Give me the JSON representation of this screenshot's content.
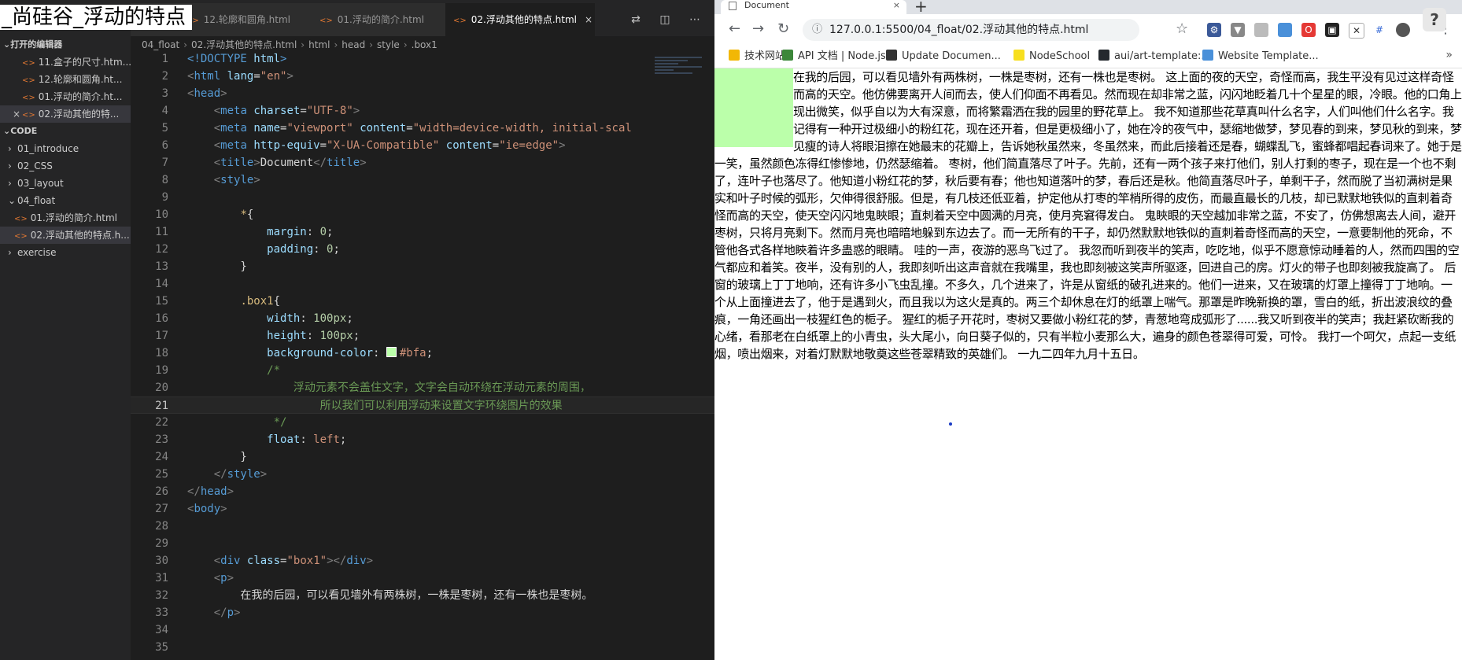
{
  "overlay_title": "_尚硅谷_浮动的特点",
  "vscode": {
    "sidebar": {
      "open_editors_title": "打开的编辑器",
      "open_editors": [
        {
          "label": "11.盒子的尺寸.htm..."
        },
        {
          "label": "12.轮廓和圆角.ht..."
        },
        {
          "label": "01.浮动的简介.ht..."
        },
        {
          "label": "02.浮动其他的特...",
          "active": true
        }
      ],
      "workspace_title": "CODE",
      "tree": [
        {
          "label": "01_introduce",
          "chevron": "›"
        },
        {
          "label": "02_CSS",
          "chevron": "›"
        },
        {
          "label": "03_layout",
          "chevron": "›"
        },
        {
          "label": "04_float",
          "chevron": "⌄"
        },
        {
          "label": "01.浮动的简介.html",
          "child": true
        },
        {
          "label": "02.浮动其他的特点.h...",
          "child": true,
          "active": true
        },
        {
          "label": "exercise",
          "chevron": "›"
        }
      ]
    },
    "tabs": [
      {
        "label": "html"
      },
      {
        "label": "12.轮廓和圆角.html"
      },
      {
        "label": "01.浮动的简介.html"
      },
      {
        "label": "02.浮动其他的特点.html",
        "active": true
      }
    ],
    "tab_close_glyph": "×",
    "editor_actions": "⇄ ◫ ⋯",
    "breadcrumb": [
      "04_float",
      "02.浮动其他的特点.html",
      "html",
      "head",
      "style",
      ".box1"
    ],
    "current_line": 21
  },
  "browser": {
    "tab_title": "Document",
    "tab_close": "×",
    "new_tab": "+",
    "help_badge": "?",
    "nav": {
      "back": "←",
      "forward": "→",
      "reload": "↻"
    },
    "url": "127.0.0.1:5500/04_float/02.浮动其他的特点.html",
    "star": "☆",
    "bookmarks": [
      {
        "label": "技术网站",
        "color": "#f2b705"
      },
      {
        "label": "API 文档 | Node.js...",
        "color": "#3c873a"
      },
      {
        "label": "Update Documen...",
        "color": "#333333"
      },
      {
        "label": "NodeSchool",
        "color": "#f7df1e"
      },
      {
        "label": "aui/art-template:...",
        "color": "#24292e"
      },
      {
        "label": "Website Template...",
        "color": "#4a90d9"
      }
    ],
    "bookmarks_more": "»",
    "page_text": "在我的后园，可以看见墙外有两株树，一株是枣树，还有一株也是枣树。 这上面的夜的天空，奇怪而高，我生平没有见过这样奇怪而高的天空。他仿佛要离开人间而去，使人们仰面不再看见。然而现在却非常之蓝，闪闪地眨着几十个星星的眼，冷眼。他的口角上现出微笑，似乎自以为大有深意，而将繁霜洒在我的园里的野花草上。 我不知道那些花草真叫什么名字，人们叫他们什么名字。我记得有一种开过极细小的粉红花，现在还开着，但是更极细小了，她在冷的夜气中，瑟缩地做梦，梦见春的到来，梦见秋的到来，梦见瘦的诗人将眼泪擦在她最末的花瓣上，告诉她秋虽然来，冬虽然来，而此后接着还是春，蝴蝶乱飞，蜜蜂都唱起春词来了。她于是一笑，虽然颜色冻得红惨惨地，仍然瑟缩着。 枣树，他们简直落尽了叶子。先前，还有一两个孩子来打他们，别人打剩的枣子，现在是一个也不剩了，连叶子也落尽了。他知道小粉红花的梦，秋后要有春；他也知道落叶的梦，春后还是秋。他简直落尽叶子，单剩干子，然而脱了当初满树是果实和叶子时候的弧形，欠伸得很舒服。但是，有几枝还低亚着，护定他从打枣的竿梢所得的皮伤，而最直最长的几枝，却已默默地铁似的直刺着奇怪而高的天空，使天空闪闪地鬼䀹眼；直刺着天空中圆满的月亮，使月亮窘得发白。 鬼䀹眼的天空越加非常之蓝，不安了，仿佛想离去人间，避开枣树，只将月亮剩下。然而月亮也暗暗地躲到东边去了。而一无所有的干子，却仍然默默地铁似的直刺着奇怪而高的天空，一意要制他的死命，不管他各式各样地䀹着许多蛊惑的眼睛。 哇的一声，夜游的恶鸟飞过了。 我忽而听到夜半的笑声，吃吃地，似乎不愿意惊动睡着的人，然而四围的空气都应和着笑。夜半，没有别的人，我即刻听出这声音就在我嘴里，我也即刻被这笑声所驱逐，回进自己的房。灯火的带子也即刻被我旋高了。 后窗的玻璃上丁丁地响，还有许多小飞虫乱撞。不多久，几个进来了，许是从窗纸的破孔进来的。他们一进来，又在玻璃的灯罩上撞得丁丁地响。一个从上面撞进去了，他于是遇到火，而且我以为这火是真的。两三个却休息在灯的纸罩上喘气。那罩是昨晚新换的罩，雪白的纸，折出波浪纹的叠痕，一角还画出一枝猩红色的栀子。 猩红的栀子开花时，枣树又要做小粉红花的梦，青葱地弯成弧形了......我又听到夜半的笑声；我赶紧砍断我的心绪，看那老在白纸罩上的小青虫，头大尾小，向日葵子似的，只有半粒小麦那么大，遍身的颜色苍翠得可爱，可怜。 我打一个呵欠，点起一支纸烟，喷出烟来，对着灯默默地敬奠这些苍翠精致的英雄们。 一九二四年九月十五日。"
  }
}
